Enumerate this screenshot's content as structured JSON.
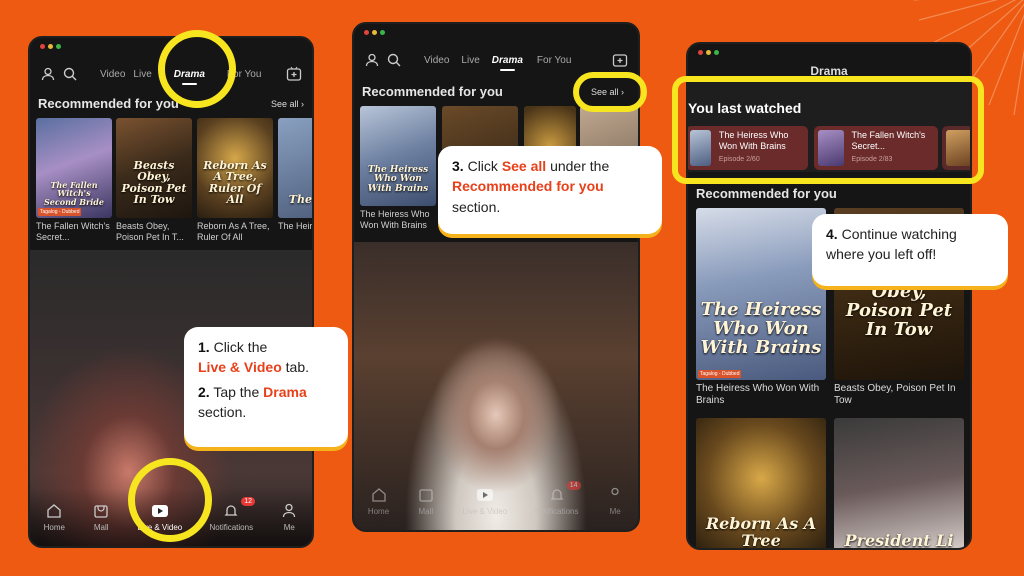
{
  "colors": {
    "background": "#ee5a12",
    "highlight": "#f6e51f",
    "accent_text": "#e8401a"
  },
  "panel1": {
    "nav_tabs": [
      "Video",
      "Live",
      "Drama",
      "For You"
    ],
    "section_title": "Recommended for you",
    "see_all": "See all",
    "cards": [
      {
        "caption": "The Fallen Witch's Secret...",
        "poster_title": "The Fallen Witch's Second Bride",
        "tag": "Tagalog - Dubbed"
      },
      {
        "caption": "Beasts Obey, Poison Pet In T...",
        "poster_title": "Beasts Obey, Poison Pet In Tow"
      },
      {
        "caption": "Reborn As A Tree, Ruler Of All",
        "poster_title": "Reborn As A Tree, Ruler Of All"
      },
      {
        "caption": "The Heir Won",
        "poster_title": "The Heir"
      }
    ],
    "bottom_nav": [
      {
        "label": "Home",
        "icon": "home-icon"
      },
      {
        "label": "Mall",
        "icon": "mall-icon"
      },
      {
        "label": "Live & Video",
        "icon": "video-icon"
      },
      {
        "label": "Notifications",
        "icon": "bell-icon",
        "badge": "12"
      },
      {
        "label": "Me",
        "icon": "user-icon"
      }
    ]
  },
  "panel2": {
    "nav_tabs": [
      "Video",
      "Live",
      "Drama",
      "For You"
    ],
    "section_title": "Recommended for you",
    "see_all": "See all",
    "card_caption": "The Heiress Who Won With Brains",
    "poster_title": "The Heiress Who Won With Brains",
    "bottom_nav": [
      {
        "label": "Home",
        "icon": "home-icon"
      },
      {
        "label": "Mall",
        "icon": "mall-icon"
      },
      {
        "label": "Live & Video",
        "icon": "video-icon"
      },
      {
        "label": "Notifications",
        "icon": "bell-icon",
        "badge": "14"
      },
      {
        "label": "Me",
        "icon": "user-icon"
      }
    ]
  },
  "panel3": {
    "header": "Drama",
    "last_watched_title": "You last watched",
    "last_watched": [
      {
        "title": "The Heiress Who Won With Brains",
        "episode": "Episode 2/60"
      },
      {
        "title": "The Fallen Witch's Secret...",
        "episode": "Episode 2/83"
      }
    ],
    "section_title": "Recommended for you",
    "cards": [
      {
        "caption": "The Heiress Who Won With Brains",
        "poster_title": "The Heiress Who Won With Brains",
        "tag": "Tagalog - Dubbed"
      },
      {
        "caption": "Beasts Obey, Poison Pet In Tow",
        "poster_title": "Beasts Obey, Poison Pet In Tow"
      },
      {
        "caption": "",
        "poster_title": "Reborn As A Tree"
      },
      {
        "caption": "",
        "poster_title": "President Li"
      }
    ]
  },
  "callouts": {
    "step1": {
      "num": "1.",
      "pre": "Click the",
      "hl": "Live & Video",
      "post": "tab."
    },
    "step2": {
      "num": "2.",
      "pre": "Tap the",
      "hl": "Drama",
      "post": "section."
    },
    "step3": {
      "num": "3.",
      "pre": "Click",
      "hl": "See all",
      "mid": "under the",
      "hl2": "Recommended for you",
      "post": "section."
    },
    "step4": {
      "num": "4.",
      "text": "Continue watching where you left off!"
    }
  }
}
